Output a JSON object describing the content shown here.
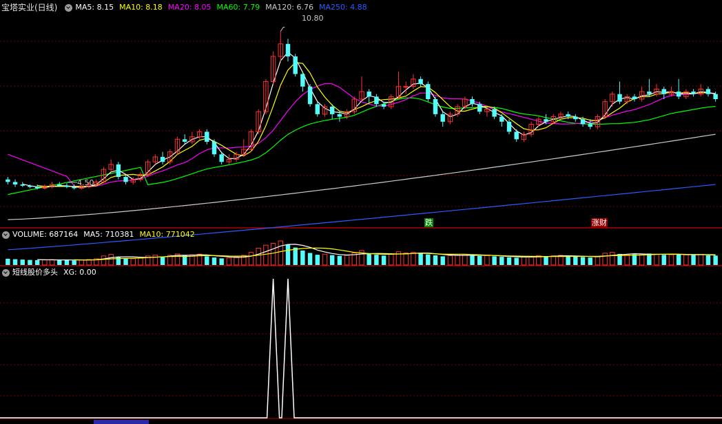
{
  "price_panel": {
    "stock_title": "宝塔实业(日线)",
    "ma_items": [
      {
        "label": "MA5: 8.15",
        "color": "#ffffff"
      },
      {
        "label": "MA10: 8.18",
        "color": "#ffff00"
      },
      {
        "label": "MA20: 8.05",
        "color": "#ff00ff"
      },
      {
        "label": "MA60: 7.79",
        "color": "#00ff00"
      },
      {
        "label": "MA120: 6.76",
        "color": "#cccccc"
      },
      {
        "label": "MA250: 4.88",
        "color": "#2b5cff"
      }
    ],
    "high_label": "10.80",
    "low_label": "4.50",
    "signal_down": "跌",
    "signal_up": "涨财"
  },
  "volume_panel": {
    "items": [
      {
        "label": "VOLUME: 687164",
        "color": "#ffffff"
      },
      {
        "label": "MA5: 710381",
        "color": "#ffffff"
      },
      {
        "label": "MA10: 771042",
        "color": "#ffff00"
      }
    ]
  },
  "indicator_panel": {
    "items": [
      {
        "label": "短线股价多头",
        "color": "#ffffff"
      },
      {
        "label": "XG: 0.00",
        "color": "#ffffff"
      }
    ]
  },
  "colors": {
    "up": "#ff3232",
    "down": "#54fcfc",
    "grid": "#7a0000",
    "ma5": "#ffffff",
    "ma10": "#ffff00",
    "ma20": "#ff00ff",
    "ma60": "#00ff00",
    "ma120": "#cccccc",
    "ma250": "#2b5cff"
  },
  "chart_data": {
    "type": "candlestick",
    "candles": [
      [
        4.9,
        4.8,
        5.0,
        4.7
      ],
      [
        4.8,
        4.7,
        4.9,
        4.6
      ],
      [
        4.7,
        4.65,
        4.8,
        4.6
      ],
      [
        4.65,
        4.6,
        4.7,
        4.55
      ],
      [
        4.6,
        4.55,
        4.7,
        4.5
      ],
      [
        4.55,
        4.6,
        4.7,
        4.5
      ],
      [
        4.6,
        4.7,
        4.8,
        4.55
      ],
      [
        4.7,
        4.65,
        4.8,
        4.6
      ],
      [
        4.65,
        4.6,
        4.75,
        4.55
      ],
      [
        4.6,
        4.55,
        4.7,
        4.5
      ],
      [
        4.55,
        4.6,
        4.7,
        4.5
      ],
      [
        4.6,
        4.7,
        4.8,
        4.55
      ],
      [
        4.7,
        4.8,
        4.9,
        4.65
      ],
      [
        4.8,
        5.3,
        5.4,
        4.75
      ],
      [
        5.3,
        5.5,
        5.7,
        5.2
      ],
      [
        5.5,
        5.0,
        5.6,
        4.9
      ],
      [
        5.0,
        4.8,
        5.1,
        4.7
      ],
      [
        4.8,
        4.9,
        5.0,
        4.7
      ],
      [
        4.9,
        5.1,
        5.2,
        4.8
      ],
      [
        5.1,
        5.6,
        5.7,
        5.0
      ],
      [
        5.6,
        5.8,
        5.9,
        5.5
      ],
      [
        5.8,
        5.6,
        6.0,
        5.5
      ],
      [
        5.6,
        6.0,
        6.1,
        5.5
      ],
      [
        6.0,
        6.5,
        6.6,
        5.9
      ],
      [
        6.5,
        6.4,
        6.7,
        6.3
      ],
      [
        6.4,
        6.6,
        6.8,
        6.3
      ],
      [
        6.6,
        6.8,
        6.9,
        6.5
      ],
      [
        6.8,
        6.4,
        6.9,
        6.3
      ],
      [
        6.4,
        5.9,
        6.5,
        5.8
      ],
      [
        5.9,
        5.6,
        6.0,
        5.5
      ],
      [
        5.6,
        5.7,
        5.9,
        5.5
      ],
      [
        5.7,
        5.9,
        6.0,
        5.6
      ],
      [
        5.9,
        6.1,
        6.5,
        5.8
      ],
      [
        6.1,
        6.8,
        6.9,
        6.0
      ],
      [
        6.8,
        7.6,
        7.7,
        6.7
      ],
      [
        7.6,
        8.8,
        8.9,
        7.5
      ],
      [
        8.8,
        9.8,
        10.0,
        8.7
      ],
      [
        9.8,
        10.3,
        10.8,
        9.6
      ],
      [
        10.3,
        9.8,
        10.5,
        9.6
      ],
      [
        9.8,
        9.1,
        9.9,
        9.0
      ],
      [
        9.1,
        8.6,
        9.2,
        8.4
      ],
      [
        8.6,
        7.9,
        8.7,
        7.8
      ],
      [
        7.9,
        7.5,
        8.0,
        7.4
      ],
      [
        7.5,
        7.8,
        7.9,
        7.4
      ],
      [
        7.8,
        7.5,
        7.9,
        7.3
      ],
      [
        7.5,
        7.4,
        7.6,
        7.2
      ],
      [
        7.4,
        7.6,
        7.7,
        7.3
      ],
      [
        7.6,
        8.1,
        8.2,
        7.5
      ],
      [
        8.1,
        8.4,
        9.0,
        8.0
      ],
      [
        8.4,
        8.2,
        8.5,
        7.9
      ],
      [
        8.2,
        7.9,
        8.3,
        7.8
      ],
      [
        7.9,
        7.8,
        8.0,
        7.7
      ],
      [
        7.8,
        8.2,
        8.3,
        7.7
      ],
      [
        8.2,
        8.6,
        9.2,
        8.1
      ],
      [
        8.6,
        8.6,
        8.8,
        8.3
      ],
      [
        8.6,
        8.9,
        9.1,
        8.5
      ],
      [
        8.9,
        8.7,
        9.0,
        8.6
      ],
      [
        8.7,
        8.1,
        8.8,
        8.0
      ],
      [
        8.1,
        7.5,
        8.2,
        7.4
      ],
      [
        7.5,
        7.2,
        7.6,
        7.0
      ],
      [
        7.2,
        7.5,
        7.6,
        7.1
      ],
      [
        7.5,
        7.8,
        7.9,
        7.4
      ],
      [
        7.8,
        8.1,
        8.2,
        7.7
      ],
      [
        8.1,
        7.9,
        8.2,
        7.8
      ],
      [
        7.9,
        7.6,
        8.0,
        7.5
      ],
      [
        7.6,
        7.7,
        7.8,
        7.4
      ],
      [
        7.7,
        7.4,
        7.8,
        7.3
      ],
      [
        7.4,
        7.2,
        7.5,
        7.0
      ],
      [
        7.2,
        6.8,
        7.3,
        6.7
      ],
      [
        6.8,
        6.5,
        6.9,
        6.4
      ],
      [
        6.5,
        6.7,
        6.8,
        6.4
      ],
      [
        6.7,
        7.1,
        7.2,
        6.6
      ],
      [
        7.1,
        7.3,
        7.4,
        7.0
      ],
      [
        7.3,
        7.2,
        7.5,
        7.1
      ],
      [
        7.2,
        7.4,
        7.5,
        7.1
      ],
      [
        7.4,
        7.5,
        7.6,
        7.3
      ],
      [
        7.5,
        7.4,
        7.6,
        7.3
      ],
      [
        7.4,
        7.3,
        7.5,
        7.2
      ],
      [
        7.3,
        7.1,
        7.4,
        7.0
      ],
      [
        7.1,
        7.0,
        7.3,
        6.9
      ],
      [
        7.0,
        7.4,
        7.5,
        6.9
      ],
      [
        7.4,
        8.0,
        8.1,
        7.3
      ],
      [
        8.0,
        8.3,
        8.4,
        7.8
      ],
      [
        8.3,
        8.0,
        8.8,
        7.9
      ],
      [
        8.0,
        8.2,
        8.3,
        7.9
      ],
      [
        8.2,
        8.1,
        8.3,
        8.0
      ],
      [
        8.1,
        8.4,
        8.6,
        8.0
      ],
      [
        8.4,
        8.3,
        8.9,
        8.2
      ],
      [
        8.3,
        8.5,
        8.7,
        8.2
      ],
      [
        8.5,
        8.3,
        8.6,
        8.1
      ],
      [
        8.3,
        8.4,
        8.6,
        8.2
      ],
      [
        8.4,
        8.2,
        8.9,
        8.1
      ],
      [
        8.2,
        8.4,
        8.5,
        8.1
      ],
      [
        8.4,
        8.3,
        8.5,
        8.2
      ],
      [
        8.3,
        8.5,
        8.7,
        8.2
      ],
      [
        8.5,
        8.3,
        8.6,
        8.2
      ],
      [
        8.3,
        8.1,
        8.4,
        8.0
      ]
    ],
    "volumes": [
      52,
      48,
      45,
      42,
      40,
      42,
      45,
      43,
      40,
      38,
      42,
      46,
      52,
      75,
      88,
      70,
      55,
      52,
      58,
      75,
      82,
      70,
      80,
      92,
      78,
      85,
      90,
      72,
      62,
      55,
      58,
      68,
      80,
      105,
      140,
      165,
      180,
      200,
      170,
      145,
      120,
      100,
      85,
      90,
      82,
      76,
      80,
      100,
      120,
      95,
      85,
      78,
      88,
      110,
      100,
      105,
      95,
      88,
      80,
      72,
      78,
      82,
      88,
      80,
      75,
      78,
      72,
      68,
      64,
      60,
      66,
      72,
      78,
      74,
      76,
      80,
      74,
      70,
      66,
      62,
      70,
      98,
      105,
      92,
      85,
      88,
      90,
      95,
      88,
      84,
      86,
      90,
      84,
      82,
      86,
      80,
      78
    ],
    "price_range": [
      3.0,
      11.5
    ],
    "volume_max": 200,
    "xg_signals": [
      36,
      38
    ]
  }
}
